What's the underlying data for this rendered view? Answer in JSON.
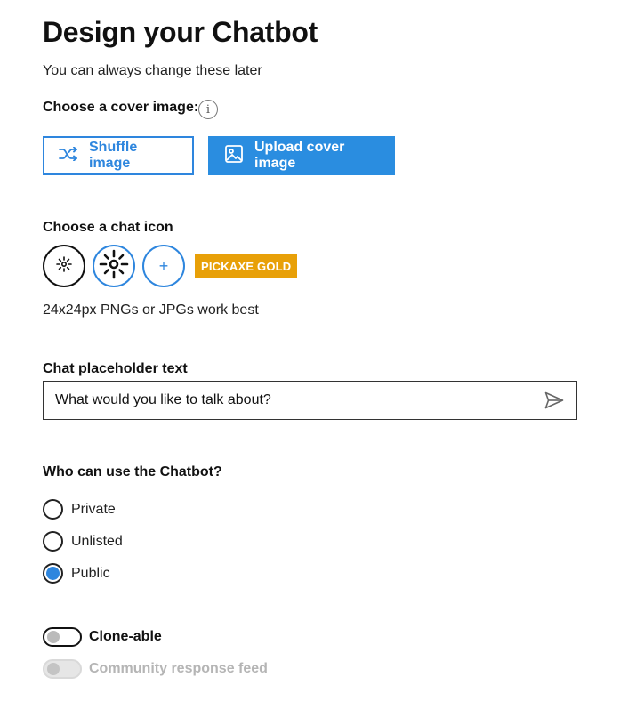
{
  "header": {
    "title": "Design your Chatbot",
    "subtitle": "You can always change these later"
  },
  "cover": {
    "label": "Choose a cover image:",
    "info_icon": "info-icon",
    "shuffle_label": "Shuffle image",
    "upload_label": "Upload cover image"
  },
  "chat_icon": {
    "label": "Choose a chat icon",
    "plus_symbol": "+",
    "gold_badge": "PICKAXE GOLD",
    "hint": "24x24px PNGs or JPGs work best"
  },
  "placeholder": {
    "label": "Chat placeholder text",
    "value": "What would you like to talk about?"
  },
  "access": {
    "label": "Who can use the Chatbot?",
    "options": [
      "Private",
      "Unlisted",
      "Public"
    ],
    "selected": "Public"
  },
  "toggles": {
    "clone_label": "Clone-able",
    "clone_on": false,
    "feed_label": "Community response feed",
    "feed_on": false,
    "feed_disabled": true
  },
  "colors": {
    "accent": "#2e86de",
    "gold": "#e8a008"
  }
}
